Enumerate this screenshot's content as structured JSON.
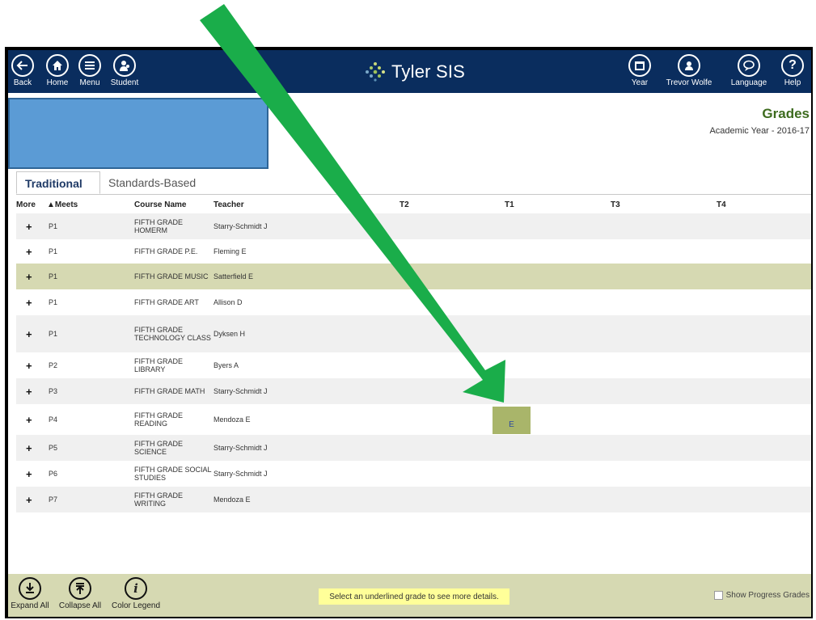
{
  "nav": {
    "back": "Back",
    "home": "Home",
    "menu": "Menu",
    "student": "Student",
    "brand": "Tyler SIS",
    "year": "Year",
    "user": "Trevor Wolfe",
    "language": "Language",
    "help": "Help"
  },
  "header": {
    "title": "Grades",
    "academic_year": "Academic Year - 2016-17"
  },
  "tabs": [
    "Traditional",
    "Standards-Based"
  ],
  "columns": {
    "more": "More",
    "meets": "▲Meets",
    "course": "Course Name",
    "teacher": "Teacher",
    "t2": "T2",
    "t1": "T1",
    "t3": "T3",
    "t4": "T4"
  },
  "rows": [
    {
      "meets": "P1",
      "course": "FIFTH GRADE HOMERM",
      "teacher": "Starry-Schmidt J"
    },
    {
      "meets": "P1",
      "course": "FIFTH GRADE P.E.",
      "teacher": "Fleming E"
    },
    {
      "meets": "P1",
      "course": "FIFTH GRADE MUSIC",
      "teacher": "Satterfield E"
    },
    {
      "meets": "P1",
      "course": "FIFTH GRADE ART",
      "teacher": "Allison D"
    },
    {
      "meets": "P1",
      "course": "FIFTH GRADE TECHNOLOGY CLASS",
      "teacher": "Dyksen H"
    },
    {
      "meets": "P2",
      "course": "FIFTH GRADE LIBRARY",
      "teacher": "Byers A"
    },
    {
      "meets": "P3",
      "course": "FIFTH GRADE MATH",
      "teacher": "Starry-Schmidt J"
    },
    {
      "meets": "P4",
      "course": "FIFTH GRADE READING",
      "teacher": "Mendoza E",
      "t1": "E"
    },
    {
      "meets": "P5",
      "course": "FIFTH GRADE SCIENCE",
      "teacher": "Starry-Schmidt J"
    },
    {
      "meets": "P6",
      "course": "FIFTH GRADE SOCIAL STUDIES",
      "teacher": "Starry-Schmidt J"
    },
    {
      "meets": "P7",
      "course": "FIFTH GRADE WRITING",
      "teacher": "Mendoza E"
    }
  ],
  "footer": {
    "expand": "Expand All",
    "collapse": "Collapse All",
    "legend": "Color Legend",
    "hint": "Select an underlined grade to see more details.",
    "progress": "Show Progress Grades"
  },
  "colors": {
    "nav_bg": "#0a2d5e",
    "highlight_row": "#d6d9b2",
    "grade_cell": "#a9b56a",
    "arrow": "#1aad4a",
    "title": "#3d6b1e"
  }
}
